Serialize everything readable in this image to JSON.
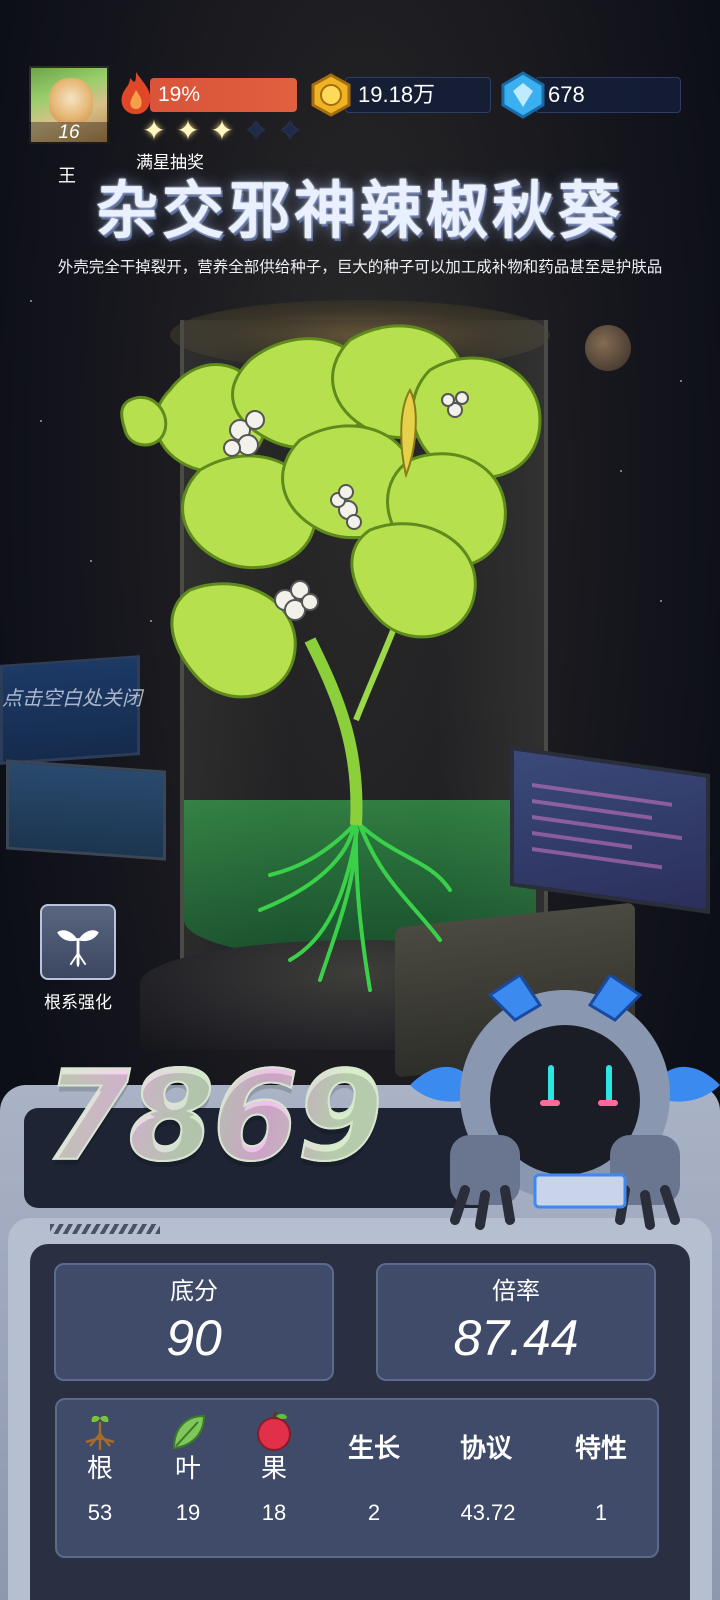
{
  "player": {
    "level": "16",
    "fire_percent": "19%",
    "stars_filled": 3,
    "stars_total": 5,
    "lottery_label": "满星抽奖"
  },
  "resources": {
    "coins": "19.18万",
    "gems": "678"
  },
  "plant": {
    "rank_tag": "王",
    "name": "杂交邪神辣椒秋葵",
    "description": "外壳完全干掉裂开，营养全部供给种子，巨大的种子可以加工成补物和药品甚至是护肤品"
  },
  "hints": {
    "close": "点击空白处关闭",
    "root_boost": "根系强化"
  },
  "score": {
    "total": "7869",
    "base_label": "底分",
    "base_value": "90",
    "multiplier_label": "倍率",
    "multiplier_value": "87.44"
  },
  "stats": [
    {
      "label": "根",
      "value": "53",
      "icon": "root-icon"
    },
    {
      "label": "叶",
      "value": "19",
      "icon": "leaf-icon"
    },
    {
      "label": "果",
      "value": "18",
      "icon": "fruit-icon"
    },
    {
      "label": "生长",
      "value": "2"
    },
    {
      "label": "协议",
      "value": "43.72"
    },
    {
      "label": "特性",
      "value": "1"
    }
  ],
  "colors": {
    "fire_bar": "#d9543a",
    "panel": "#3f4b68",
    "leaf": "#b7e04e"
  }
}
